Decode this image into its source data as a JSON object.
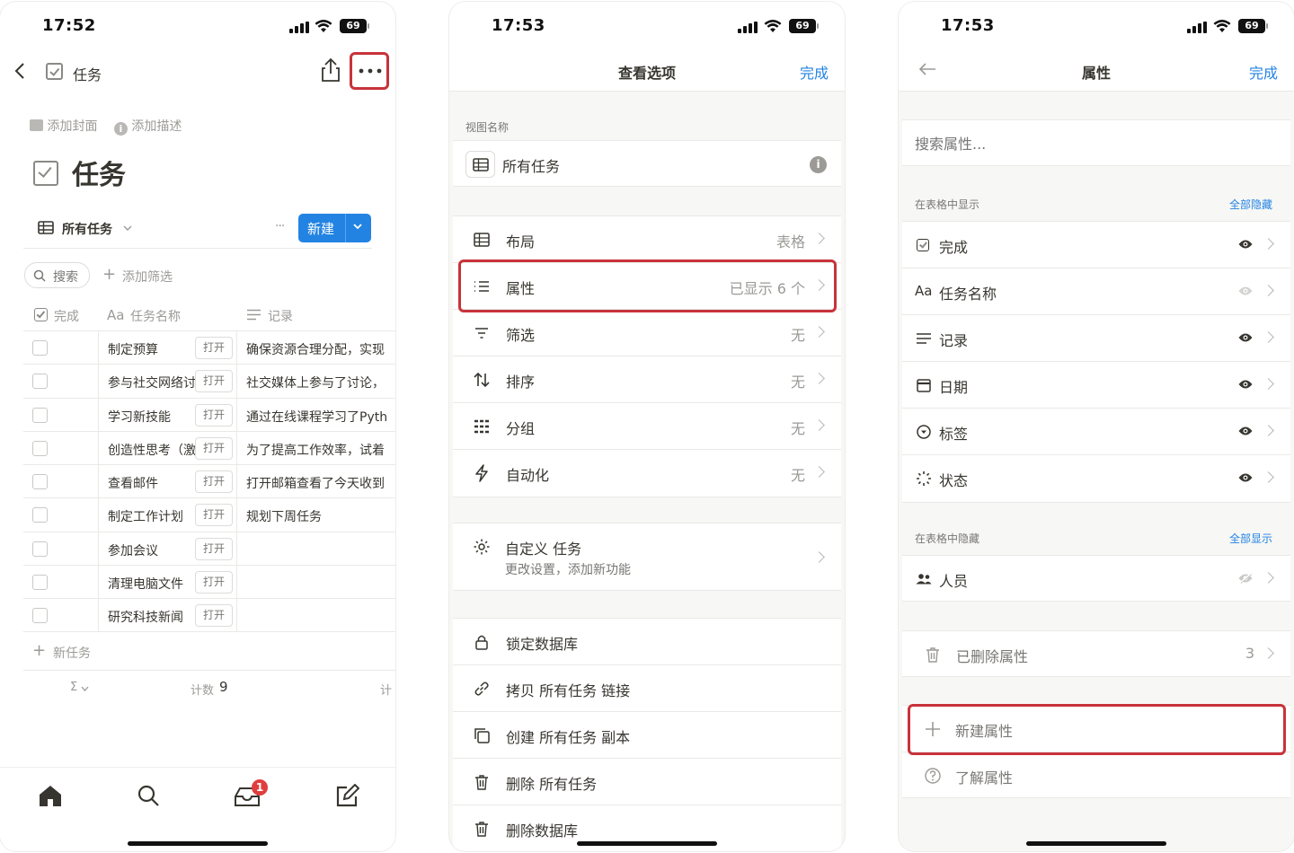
{
  "colors": {
    "accent": "#2383e2",
    "highlight": "#c8333a",
    "badge": "#e03e3e"
  },
  "phone1": {
    "status": {
      "time": "17:52",
      "battery": "69"
    },
    "nav": {
      "title": "任务"
    },
    "page_actions": {
      "add_cover": "添加封面",
      "add_description": "添加描述"
    },
    "page_title": "任务",
    "view": {
      "name": "所有任务",
      "more": "···",
      "new_button": "新建"
    },
    "filters": {
      "search": "搜索",
      "add_filter": "添加筛选"
    },
    "columns": {
      "done": "完成",
      "name": "任务名称",
      "name_prefix": "Aa",
      "notes": "记录"
    },
    "rows": [
      {
        "name": "制定预算",
        "open": "打开",
        "note": "确保资源合理分配，实现"
      },
      {
        "name": "参与社交网络讨论",
        "open": "打开",
        "note": "社交媒体上参与了讨论，"
      },
      {
        "name": "学习新技能",
        "open": "打开",
        "note": "通过在线课程学习了Pyth"
      },
      {
        "name": "创造性思考（激",
        "open": "打开",
        "note": "为了提高工作效率，试着"
      },
      {
        "name": "查看邮件",
        "open": "打开",
        "note": "打开邮箱查看了今天收到"
      },
      {
        "name": "制定工作计划",
        "open": "打开",
        "note": "规划下周任务"
      },
      {
        "name": "参加会议",
        "open": "打开",
        "note": ""
      },
      {
        "name": "清理电脑文件",
        "open": "打开",
        "note": ""
      },
      {
        "name": "研究科技新闻",
        "open": "打开",
        "note": ""
      }
    ],
    "new_task": "新任务",
    "footer": {
      "sigma": "Σ",
      "count_label": "计数",
      "count": "9",
      "cut": "计"
    },
    "tabbar": {
      "inbox_badge": "1"
    }
  },
  "phone2": {
    "status": {
      "time": "17:53",
      "battery": "69"
    },
    "title": "查看选项",
    "done": "完成",
    "view_name_label": "视图名称",
    "view_name": "所有任务",
    "options": [
      {
        "label": "布局",
        "value": "表格",
        "icon": "table-icon"
      },
      {
        "label": "属性",
        "value": "已显示 6 个",
        "icon": "list-icon"
      },
      {
        "label": "筛选",
        "value": "无",
        "icon": "filter-icon"
      },
      {
        "label": "排序",
        "value": "无",
        "icon": "sort-icon"
      },
      {
        "label": "分组",
        "value": "无",
        "icon": "group-icon"
      },
      {
        "label": "自动化",
        "value": "无",
        "icon": "lightning-icon"
      }
    ],
    "customize": {
      "title": "自定义 任务",
      "subtitle": "更改设置，添加新功能"
    },
    "actions": [
      {
        "label": "锁定数据库",
        "icon": "lock-icon"
      },
      {
        "label": "拷贝 所有任务 链接",
        "icon": "link-icon"
      },
      {
        "label": "创建 所有任务 副本",
        "icon": "duplicate-icon"
      },
      {
        "label": "删除 所有任务",
        "icon": "trash-icon"
      },
      {
        "label": "删除数据库",
        "icon": "trash-icon"
      }
    ]
  },
  "phone3": {
    "status": {
      "time": "17:53",
      "battery": "69"
    },
    "title": "属性",
    "done": "完成",
    "search_placeholder": "搜索属性...",
    "shown_label": "在表格中显示",
    "hide_all": "全部隐藏",
    "shown": [
      {
        "label": "完成",
        "icon": "checkbox-icon"
      },
      {
        "label": "任务名称",
        "icon": "title-icon",
        "prefix": "Aa"
      },
      {
        "label": "记录",
        "icon": "text-icon"
      },
      {
        "label": "日期",
        "icon": "calendar-icon"
      },
      {
        "label": "标签",
        "icon": "select-icon"
      },
      {
        "label": "状态",
        "icon": "status-icon"
      }
    ],
    "hidden_label": "在表格中隐藏",
    "show_all": "全部显示",
    "hidden": [
      {
        "label": "人员",
        "icon": "people-icon"
      }
    ],
    "deleted": {
      "label": "已删除属性",
      "count": "3"
    },
    "new_property": "新建属性",
    "learn": "了解属性"
  }
}
